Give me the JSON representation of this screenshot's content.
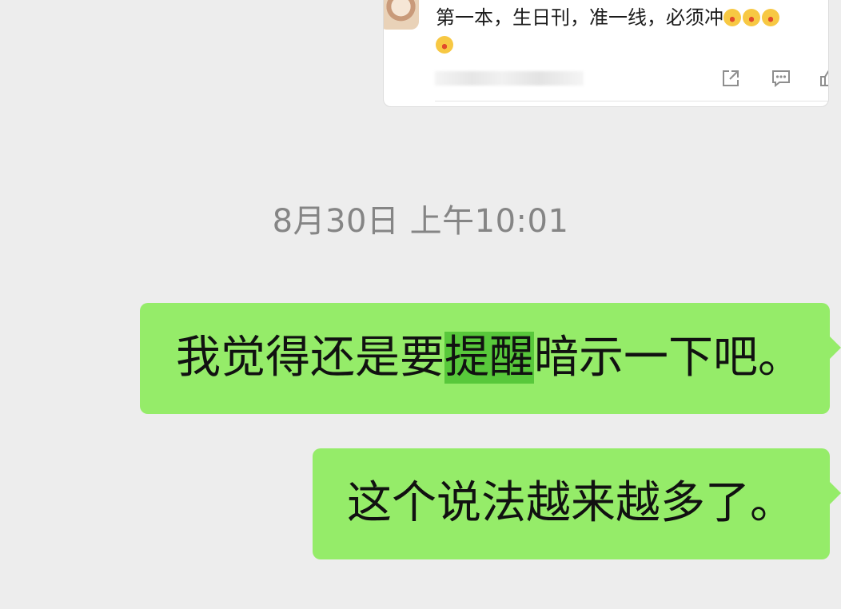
{
  "shared_card": {
    "text": "第一本，生日刊，准一线，必须冲",
    "emoji_icon": "screaming-face-emoji",
    "actions": [
      "share-icon",
      "comment-icon",
      "like-icon"
    ]
  },
  "timestamp": "8月30日 上午10:01",
  "messages": [
    {
      "before": "我觉得还是要",
      "selected": "提醒",
      "after": "暗示一下吧。"
    },
    {
      "text": "这个说法越来越多了。"
    }
  ],
  "colors": {
    "background": "#ededed",
    "bubble": "#95ec69",
    "selection": "#58c83b",
    "timestamp": "#858585"
  }
}
